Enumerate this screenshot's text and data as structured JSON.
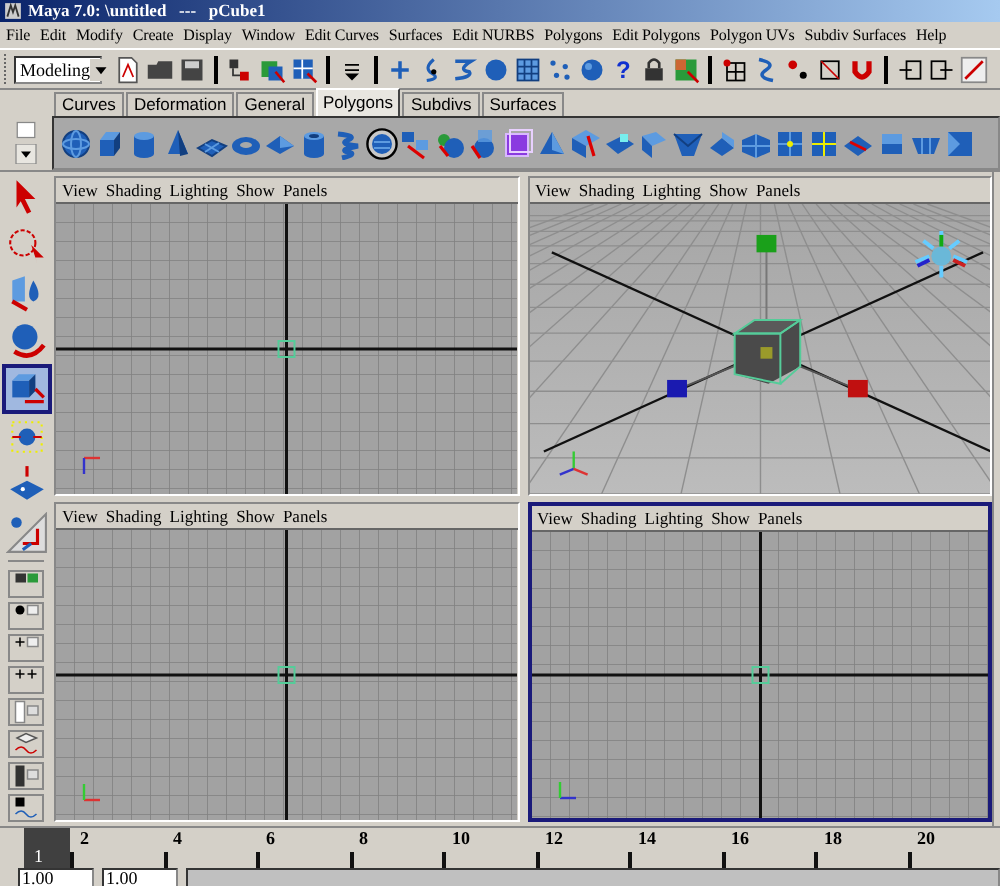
{
  "window": {
    "title": "Maya 7.0: \\untitled   ---   pCube1"
  },
  "menu_bar": [
    "File",
    "Edit",
    "Modify",
    "Create",
    "Display",
    "Window",
    "Edit Curves",
    "Surfaces",
    "Edit NURBS",
    "Polygons",
    "Edit Polygons",
    "Polygon UVs",
    "Subdiv Surfaces",
    "Help"
  ],
  "status_line": {
    "mode_menu": "Modeling",
    "help_button": "?"
  },
  "shelf": {
    "tabs": [
      {
        "label": "Curves",
        "selected": false
      },
      {
        "label": "Deformation",
        "selected": false
      },
      {
        "label": "General",
        "selected": false
      },
      {
        "label": "Polygons",
        "selected": true
      },
      {
        "label": "Subdivs",
        "selected": false
      },
      {
        "label": "Surfaces",
        "selected": false
      }
    ]
  },
  "viewports": [
    {
      "kind": "top",
      "selected": false,
      "menu": [
        "View",
        "Shading",
        "Lighting",
        "Show",
        "Panels"
      ]
    },
    {
      "kind": "persp",
      "selected": false,
      "menu": [
        "View",
        "Shading",
        "Lighting",
        "Show",
        "Panels"
      ]
    },
    {
      "kind": "front",
      "selected": false,
      "menu": [
        "View",
        "Shading",
        "Lighting",
        "Show",
        "Panels"
      ]
    },
    {
      "kind": "side",
      "selected": true,
      "menu": [
        "View",
        "Shading",
        "Lighting",
        "Show",
        "Panels"
      ]
    }
  ],
  "time_slider": {
    "current_frame": "1",
    "ticks": [
      "2",
      "4",
      "6",
      "8",
      "10",
      "12",
      "14",
      "16",
      "18",
      "20"
    ]
  },
  "range_slider": {
    "start": "1.00",
    "end": "1.00"
  }
}
